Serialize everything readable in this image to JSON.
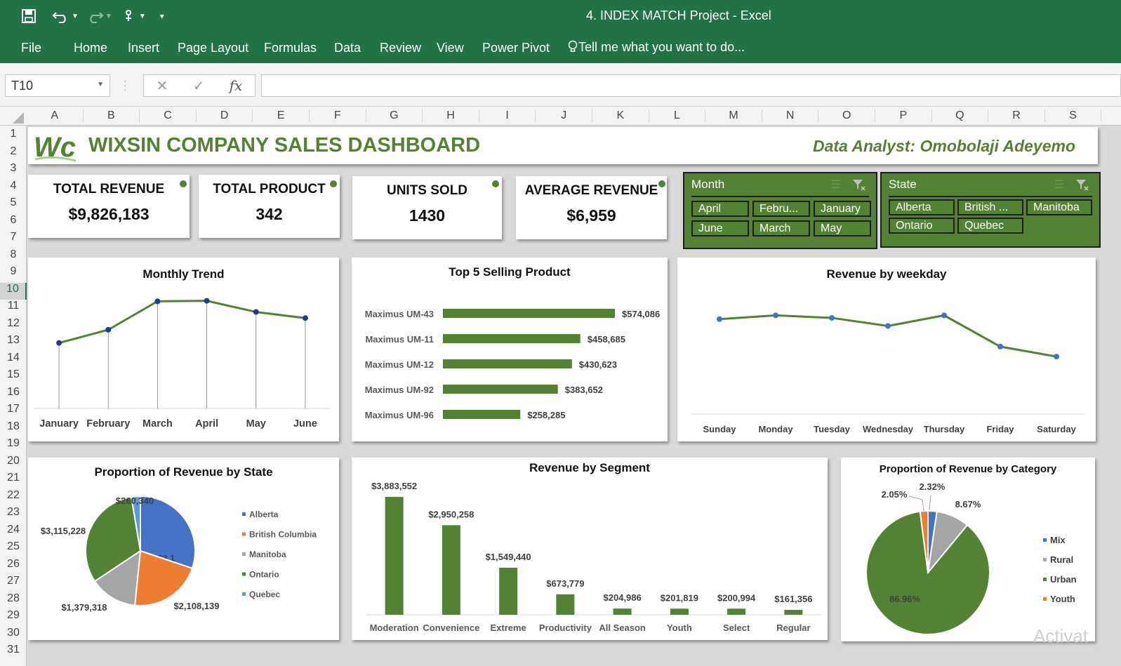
{
  "app": {
    "window_title": "4. INDEX MATCH Project - Excel",
    "menu": [
      "File",
      "Home",
      "Insert",
      "Page Layout",
      "Formulas",
      "Data",
      "Review",
      "View",
      "Power Pivot"
    ],
    "tell_me": "Tell me what you want to do...",
    "name_box": "T10",
    "fx_label": "fx",
    "columns": [
      "A",
      "B",
      "C",
      "D",
      "E",
      "F",
      "G",
      "H",
      "I",
      "J",
      "K",
      "L",
      "M",
      "N",
      "O",
      "P",
      "Q",
      "R",
      "S"
    ],
    "rows": [
      "1",
      "2",
      "3",
      "4",
      "5",
      "6",
      "7",
      "8",
      "9",
      "10",
      "11",
      "12",
      "13",
      "14",
      "15",
      "16",
      "17",
      "18",
      "19",
      "20",
      "21",
      "22",
      "23",
      "24",
      "25",
      "26",
      "27",
      "28",
      "29",
      "30",
      "31"
    ],
    "active_row": "10",
    "watermark": "Activat"
  },
  "dashboard": {
    "logo_text": "Wc",
    "title": "WIXSIN COMPANY SALES DASHBOARD",
    "analyst": "Data Analyst: Omobolaji Adeyemo",
    "accent": "#548235"
  },
  "kpis": [
    {
      "title": "TOTAL REVENUE",
      "value": "$9,826,183"
    },
    {
      "title": "TOTAL PRODUCT",
      "value": "342"
    },
    {
      "title": "UNITS SOLD",
      "value": "1430"
    },
    {
      "title": "AVERAGE REVENUE",
      "value": "$6,959"
    }
  ],
  "slicers": {
    "month": {
      "title": "Month",
      "items": [
        "April",
        "Febru...",
        "January",
        "June",
        "March",
        "May"
      ]
    },
    "state": {
      "title": "State",
      "items": [
        "Alberta",
        "British ...",
        "Manitoba",
        "Ontario",
        "Quebec"
      ]
    }
  },
  "chart_data": [
    {
      "type": "line",
      "title": "Monthly Trend",
      "categories": [
        "January",
        "February",
        "March",
        "April",
        "May",
        "June"
      ],
      "values": [
        1290000,
        1550000,
        2110000,
        2120000,
        1900000,
        1780000
      ],
      "ylim": [
        0,
        2350000
      ],
      "color": "#548235",
      "marker_color": "#1f3a93"
    },
    {
      "type": "bar",
      "orientation": "horizontal",
      "title": "Top 5 Selling Product",
      "categories": [
        "Maximus UM-43",
        "Maximus UM-11",
        "Maximus UM-12",
        "Maximus UM-92",
        "Maximus UM-96"
      ],
      "values": [
        574086,
        458685,
        430623,
        383652,
        258285
      ],
      "labels": [
        "$574,086",
        "$458,685",
        "$430,623",
        "$383,652",
        "$258,285"
      ],
      "color": "#548235"
    },
    {
      "type": "line",
      "title": "Revenue by weekday",
      "categories": [
        "Sunday",
        "Monday",
        "Tuesday",
        "Wednesday",
        "Thursday",
        "Friday",
        "Saturday"
      ],
      "values": [
        1520000,
        1580000,
        1540000,
        1410000,
        1580000,
        1080000,
        920000
      ],
      "ylim": [
        0,
        2000000
      ],
      "color": "#548235",
      "marker_color": "#4472c4"
    },
    {
      "type": "pie",
      "title": "Proportion of Revenue by State",
      "labels": [
        "Alberta",
        "British Columbia",
        "Manitoba",
        "Ontario",
        "Quebec"
      ],
      "values": [
        2963158,
        2108139,
        1379318,
        3115228,
        260340
      ],
      "value_labels": [
        "$2,963,1\n58",
        "$2,108,139",
        "$1,379,318",
        "$3,115,228",
        "$260,340"
      ],
      "colors": [
        "#4472c4",
        "#ed7d31",
        "#a5a5a5",
        "#548235",
        "#5b9bd5"
      ]
    },
    {
      "type": "bar",
      "title": "Revenue by Segment",
      "categories": [
        "Moderation",
        "Convenience",
        "Extreme",
        "Productivity",
        "All Season",
        "Youth",
        "Select",
        "Regular"
      ],
      "values": [
        3883552,
        2950258,
        1549440,
        673779,
        204986,
        201819,
        200994,
        161356
      ],
      "labels": [
        "$3,883,552",
        "$2,950,258",
        "$1,549,440",
        "$673,779",
        "$204,986",
        "$201,819",
        "$200,994",
        "$161,356"
      ],
      "color": "#548235"
    },
    {
      "type": "pie",
      "title": "Proportion of Revenue by Category",
      "labels": [
        "Mix",
        "Rural",
        "Urban",
        "Youth"
      ],
      "values": [
        2.32,
        8.67,
        86.96,
        2.05
      ],
      "value_labels": [
        "2.32%",
        "8.67%",
        "86.96%",
        "2.05%"
      ],
      "colors": [
        "#4472c4",
        "#a5a5a5",
        "#548235",
        "#ed7d31"
      ]
    }
  ]
}
